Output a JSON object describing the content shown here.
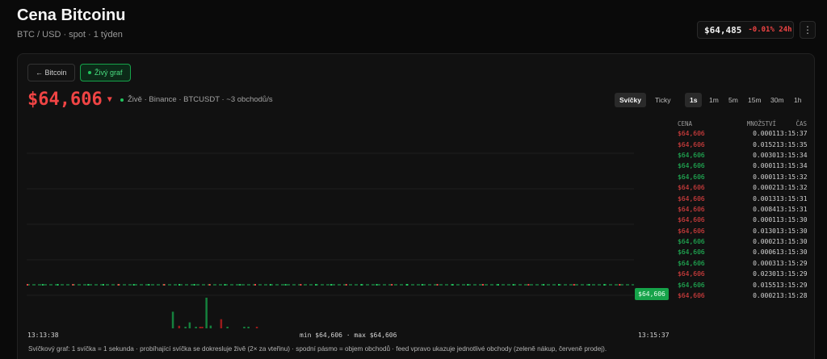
{
  "header": {
    "title": "Cena Bitcoinu",
    "subtitle": "BTC / USD · spot · 1 týden",
    "pill_price": "$64,485",
    "pill_change": "-0.01% 24h",
    "more_label": "⋮"
  },
  "toolbar": {
    "back_label": "← Bitcoin",
    "live_label": "Živý graf"
  },
  "live": {
    "price": "$64,606",
    "direction_arrow": "▼",
    "info": "Živě · Binance · BTCUSDT · ~3 obchodů/s"
  },
  "modes": [
    "Svíčky",
    "Ticky"
  ],
  "active_mode": "Svíčky",
  "intervals": [
    "1s",
    "1m",
    "5m",
    "15m",
    "30m",
    "1h"
  ],
  "active_interval": "1s",
  "colors": {
    "up": "#22c55e",
    "down": "#ef4444",
    "accent": "#16a34a"
  },
  "chart_data": {
    "type": "line",
    "x_start": "13:13:38",
    "x_end": "13:15:37",
    "range_label": "min $64,606 · max $64,606",
    "last_price_label": "$64,606",
    "price_value": 64606,
    "volume_bars": [
      {
        "i": 68,
        "v": 0.0084,
        "side": "buy"
      },
      {
        "i": 71,
        "v": 0.0013,
        "side": "sell"
      },
      {
        "i": 74,
        "v": 0.0001,
        "side": "buy"
      },
      {
        "i": 76,
        "v": 0.003,
        "side": "buy"
      },
      {
        "i": 79,
        "v": 0.0002,
        "side": "buy"
      },
      {
        "i": 81,
        "v": 0.0001,
        "side": "sell"
      },
      {
        "i": 82,
        "v": 0.0001,
        "side": "sell"
      },
      {
        "i": 84,
        "v": 0.0155,
        "side": "buy"
      },
      {
        "i": 86,
        "v": 0.0014,
        "side": "buy"
      },
      {
        "i": 91,
        "v": 0.0046,
        "side": "sell"
      },
      {
        "i": 94,
        "v": 0.0003,
        "side": "buy"
      },
      {
        "i": 102,
        "v": 0.0002,
        "side": "buy"
      },
      {
        "i": 104,
        "v": 0.0001,
        "side": "buy"
      },
      {
        "i": 108,
        "v": 0.0001,
        "side": "sell"
      }
    ]
  },
  "feed": {
    "headers": [
      "CENA",
      "MNOŽSTVÍ",
      "ČAS"
    ],
    "rows": [
      {
        "price": "$64,606",
        "qty": "0.0001",
        "time": "13:15:37",
        "side": "sell"
      },
      {
        "price": "$64,606",
        "qty": "0.0152",
        "time": "13:15:35",
        "side": "sell"
      },
      {
        "price": "$64,606",
        "qty": "0.0030",
        "time": "13:15:34",
        "side": "buy"
      },
      {
        "price": "$64,606",
        "qty": "0.0001",
        "time": "13:15:34",
        "side": "buy"
      },
      {
        "price": "$64,606",
        "qty": "0.0001",
        "time": "13:15:32",
        "side": "buy"
      },
      {
        "price": "$64,606",
        "qty": "0.0002",
        "time": "13:15:32",
        "side": "sell"
      },
      {
        "price": "$64,606",
        "qty": "0.0013",
        "time": "13:15:31",
        "side": "sell"
      },
      {
        "price": "$64,606",
        "qty": "0.0084",
        "time": "13:15:31",
        "side": "sell"
      },
      {
        "price": "$64,606",
        "qty": "0.0001",
        "time": "13:15:30",
        "side": "sell"
      },
      {
        "price": "$64,606",
        "qty": "0.0130",
        "time": "13:15:30",
        "side": "sell"
      },
      {
        "price": "$64,606",
        "qty": "0.0002",
        "time": "13:15:30",
        "side": "buy"
      },
      {
        "price": "$64,606",
        "qty": "0.0006",
        "time": "13:15:30",
        "side": "buy"
      },
      {
        "price": "$64,606",
        "qty": "0.0003",
        "time": "13:15:29",
        "side": "buy"
      },
      {
        "price": "$64,606",
        "qty": "0.0230",
        "time": "13:15:29",
        "side": "sell"
      },
      {
        "price": "$64,606",
        "qty": "0.0155",
        "time": "13:15:29",
        "side": "buy"
      },
      {
        "price": "$64,606",
        "qty": "0.0002",
        "time": "13:15:28",
        "side": "sell"
      }
    ]
  },
  "footnote": "Svíčkový graf: 1 svíčka = 1 sekunda · probíhající svíčka se dokresluje živě (2× za vteřinu) · spodní pásmo = objem obchodů · feed vpravo ukazuje jednotlivé obchody (zeleně nákup, červeně prodej)."
}
